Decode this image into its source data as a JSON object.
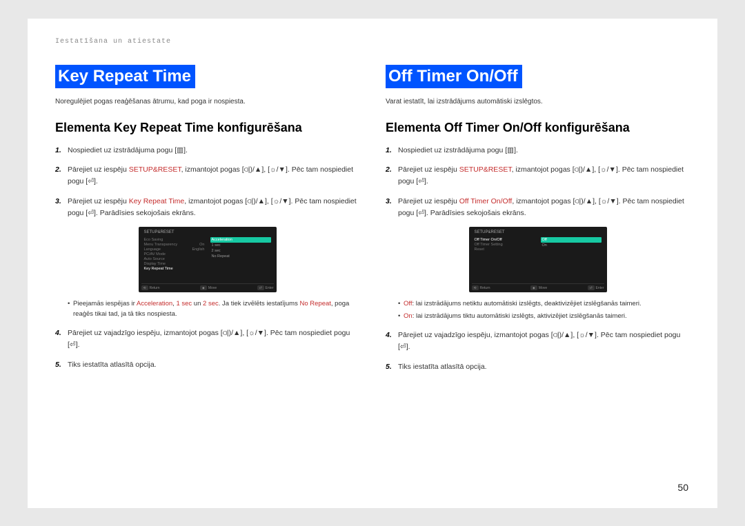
{
  "breadcrumb": "Iestatīšana un atiestate",
  "page_number": "50",
  "glyph": {
    "menu": "[▥]",
    "up": "▲",
    "down": "▼",
    "enter": "[⏎]",
    "vol": "⫏|)",
    "bright": "☼"
  },
  "left": {
    "title": "Key Repeat Time",
    "intro": "Noregulējiet pogas reaģēšanas ātrumu, kad poga ir nospiesta.",
    "subhead": "Elementa Key Repeat Time konfigurēšana",
    "steps": {
      "s1_a": "Nospiediet uz izstrādājuma pogu ",
      "s1_b": ".",
      "s2_a": "Pārejiet uz iespēju ",
      "s2_link": "SETUP&RESET",
      "s2_b": ", izmantojot pogas [",
      "s2_c": "], [",
      "s2_d": "]. Pēc tam nospiediet pogu ",
      "s3_a": "Pārejiet uz iespēju ",
      "s3_link": "Key Repeat Time",
      "s3_b": ", izmantojot pogas [",
      "s3_c": "], [",
      "s3_d": "]. Pēc tam nospiediet pogu ",
      "s3_e": ". Parādīsies sekojošais ekrāns.",
      "note_a": "Pieejamās iespējas ir ",
      "note_acc": "Acceleration",
      "note_b": ", ",
      "note_1s": "1 sec",
      "note_c": " un ",
      "note_2s": "2 sec",
      "note_d": ". Ja tiek izvēlēts iestatījums ",
      "note_nr": "No Repeat",
      "note_e": ", poga reaģēs tikai tad, ja tā tiks nospiesta.",
      "s4_a": "Pārejiet uz vajadzīgo iespēju, izmantojot pogas [",
      "s4_b": "], [",
      "s4_c": "]. Pēc tam nospiediet pogu ",
      "s5": "Tiks iestatīta atlasītā opcija."
    },
    "osd": {
      "head": "SETUP&RESET",
      "rows": [
        {
          "l": "Eco Saving",
          "r": ""
        },
        {
          "l": "Menu Transparency",
          "r": "On"
        },
        {
          "l": "Language",
          "r": "English"
        },
        {
          "l": "PC/AV Mode",
          "r": ""
        },
        {
          "l": "Auto Source",
          "r": ""
        },
        {
          "l": "Display Time",
          "r": ""
        },
        {
          "l": "Key Repeat Time",
          "r": "",
          "sel": true
        }
      ],
      "opts": [
        "Acceleration",
        "1 sec",
        "2 sec",
        "No Repeat"
      ],
      "foot": {
        "a": "Return",
        "b": "Move",
        "c": "Enter"
      }
    }
  },
  "right": {
    "title": "Off Timer On/Off",
    "intro": "Varat iestatīt, lai izstrādājums automātiski izslēgtos.",
    "subhead": "Elementa Off Timer On/Off konfigurēšana",
    "steps": {
      "s1_a": "Nospiediet uz izstrādājuma pogu ",
      "s1_b": ".",
      "s2_a": "Pārejiet uz iespēju ",
      "s2_link": "SETUP&RESET",
      "s2_b": ", izmantojot pogas [",
      "s2_c": "], [",
      "s2_d": "]. Pēc tam nospiediet pogu ",
      "s3_a": "Pārejiet uz iespēju ",
      "s3_link": "Off Timer On/Off",
      "s3_b": ", izmantojot pogas [",
      "s3_c": "], [",
      "s3_d": "]. Pēc tam nospiediet pogu ",
      "s3_e": ". Parādīsies sekojošais ekrāns.",
      "b1_l": "Off",
      "b1_t": ": lai izstrādājums netiktu automātiski izslēgts, deaktivizējiet izslēgšanās taimeri.",
      "b2_l": "On",
      "b2_t": ": lai izstrādājums tiktu automātiski izslēgts, aktivizējiet izslēgšanās taimeri.",
      "s4_a": "Pārejiet uz vajadzīgo iespēju, izmantojot pogas [",
      "s4_b": "], [",
      "s4_c": "]. Pēc tam nospiediet pogu ",
      "s5": "Tiks iestatīta atlasītā opcija."
    },
    "osd": {
      "head": "SETUP&RESET",
      "rows": [
        {
          "l": "Off Timer On/Off",
          "r": "",
          "sel": true
        },
        {
          "l": "Off Timer Setting",
          "r": ""
        },
        {
          "l": "Reset",
          "r": ""
        }
      ],
      "opts": [
        "Off",
        "On"
      ],
      "foot": {
        "a": "Return",
        "b": "Move",
        "c": "Enter"
      }
    }
  }
}
